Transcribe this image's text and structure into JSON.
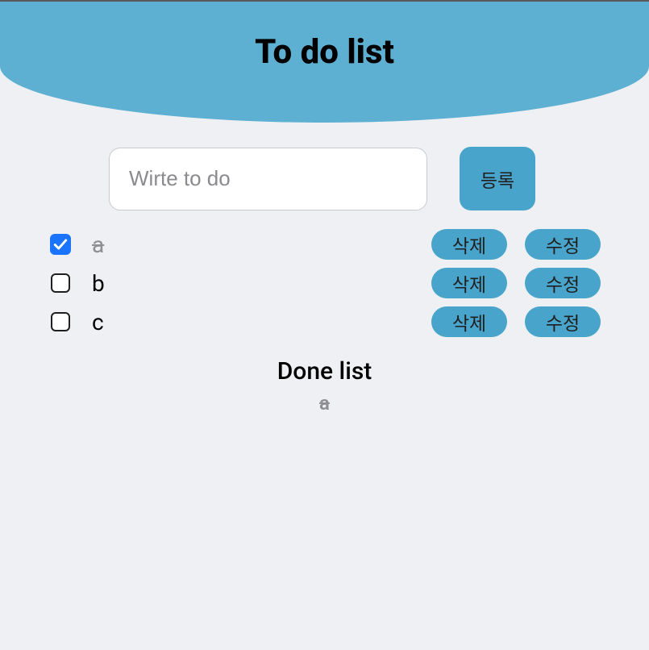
{
  "header": {
    "title": "To do list"
  },
  "input": {
    "placeholder": "Wirte to do",
    "value": ""
  },
  "buttons": {
    "register": "등록",
    "delete": "삭제",
    "edit": "수정"
  },
  "todos": [
    {
      "label": "a",
      "checked": true
    },
    {
      "label": "b",
      "checked": false
    },
    {
      "label": "c",
      "checked": false
    }
  ],
  "done": {
    "title": "Done list",
    "items": [
      {
        "label": "a"
      }
    ]
  }
}
